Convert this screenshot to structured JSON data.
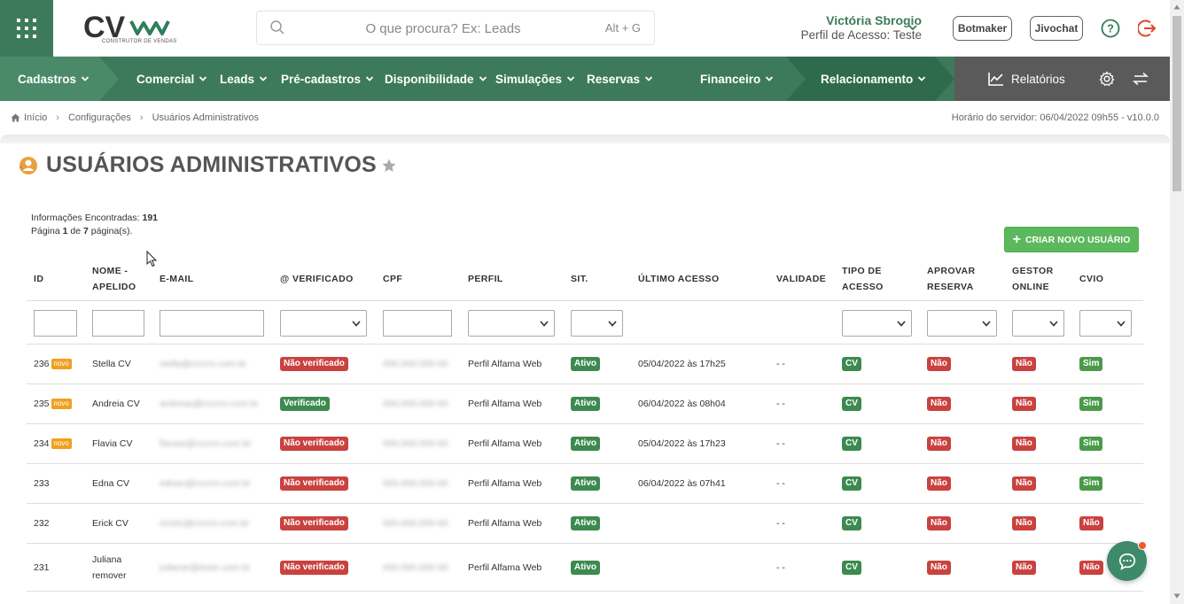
{
  "header": {
    "logo_text": "CV",
    "logo_subtitle": "CONSTRUTOR DE VENDAS",
    "search_placeholder": "O que procura? Ex: Leads",
    "search_shortcut": "Alt + G",
    "user_name": "Victória Sbrogio",
    "user_profile": "Perfil de Acesso: Teste",
    "botmaker_label": "Botmaker",
    "jivochat_label": "Jivochat"
  },
  "nav": {
    "items": [
      {
        "label": "Cadastros"
      },
      {
        "label": "Comercial"
      },
      {
        "label": "Leads"
      },
      {
        "label": "Pré-cadastros"
      },
      {
        "label": "Disponibilidade"
      },
      {
        "label": "Simulações"
      },
      {
        "label": "Reservas"
      },
      {
        "label": "Financeiro"
      },
      {
        "label": "Relacionamento"
      }
    ],
    "reports_label": "Relatórios"
  },
  "breadcrumb": {
    "home": "Início",
    "level1": "Configurações",
    "level2": "Usuários Administrativos"
  },
  "server_time": "Horário do servidor: 06/04/2022 09h55 - v10.0.0",
  "page": {
    "title": "USUÁRIOS ADMINISTRATIVOS",
    "info_found_label": "Informações Encontradas:",
    "info_found_count": "191",
    "page_word": "Página",
    "page_current": "1",
    "page_of": "de",
    "page_total": "7",
    "page_suffix": "página(s).",
    "create_button": "CRIAR NOVO USUÁRIO"
  },
  "table": {
    "headers": {
      "id": "ID",
      "nome1": "NOME -",
      "nome2": "APELIDO",
      "email": "E-MAIL",
      "verificado": "@ VERIFICADO",
      "cpf": "CPF",
      "perfil": "PERFIL",
      "sit": "SIT.",
      "ultimo": "ÚLTIMO ACESSO",
      "validade": "VALIDADE",
      "tipo1": "TIPO DE",
      "tipo2": "ACESSO",
      "aprovar1": "APROVAR",
      "aprovar2": "RESERVA",
      "gestor1": "GESTOR",
      "gestor2": "ONLINE",
      "cvio": "CVIO"
    },
    "novo_label": "novo",
    "rows": [
      {
        "id": "236",
        "nome": "Stella CV",
        "email": "stella@cvcrm.com.br",
        "verificado": "Não verificado",
        "cpf": "000.000.000-00",
        "perfil": "Perfil Alfama Web",
        "sit": "Ativo",
        "ultimo": "05/04/2022 às 17h25",
        "validade": "- -",
        "tipo": "CV",
        "aprovar": "Não",
        "gestor": "Não",
        "cvio": "Sim"
      },
      {
        "id": "235",
        "nome": "Andreia CV",
        "email": "andreas@cvcrm.com.br",
        "verificado": "Verificado",
        "cpf": "000.000.000-00",
        "perfil": "Perfil Alfama Web",
        "sit": "Ativo",
        "ultimo": "06/04/2022 às 08h04",
        "validade": "- -",
        "tipo": "CV",
        "aprovar": "Não",
        "gestor": "Não",
        "cvio": "Sim"
      },
      {
        "id": "234",
        "nome": "Flavia CV",
        "email": "flavias@cvcrm.com.br",
        "verificado": "Não verificado",
        "cpf": "000.000.000-00",
        "perfil": "Perfil Alfama Web",
        "sit": "Ativo",
        "ultimo": "05/04/2022 às 17h23",
        "validade": "- -",
        "tipo": "CV",
        "aprovar": "Não",
        "gestor": "Não",
        "cvio": "Sim"
      },
      {
        "id": "233",
        "nome": "Edna CV",
        "email": "ednan@cvcrm.com.br",
        "verificado": "Não verificado",
        "cpf": "000.000.000-00",
        "perfil": "Perfil Alfama Web",
        "sit": "Ativo",
        "ultimo": "06/04/2022 às 07h41",
        "validade": "- -",
        "tipo": "CV",
        "aprovar": "Não",
        "gestor": "Não",
        "cvio": "Sim"
      },
      {
        "id": "232",
        "nome": "Erick CV",
        "email": "ericks@cvcrm.com.br",
        "verificado": "Não verificado",
        "cpf": "000.000.000-00",
        "perfil": "Perfil Alfama Web",
        "sit": "Ativo",
        "ultimo": "",
        "validade": "- -",
        "tipo": "CV",
        "aprovar": "Não",
        "gestor": "Não",
        "cvio": "Não"
      },
      {
        "id": "231",
        "nome1": "Juliana",
        "nome2": "remover",
        "email": "julianar@teste.com.br",
        "verificado": "Não verificado",
        "cpf": "000.000.000-00",
        "perfil": "Perfil Alfama Web",
        "sit": "Ativo",
        "ultimo": "",
        "validade": "- -",
        "tipo": "CV",
        "aprovar": "Não",
        "gestor": "Não",
        "cvio": "Não"
      }
    ]
  },
  "colors": {
    "brand_green": "#3d7a5b",
    "badge_red": "#c9423f",
    "badge_green": "#3d8a4f",
    "create_button": "#5cb85c",
    "novo_orange": "#f0a020"
  }
}
